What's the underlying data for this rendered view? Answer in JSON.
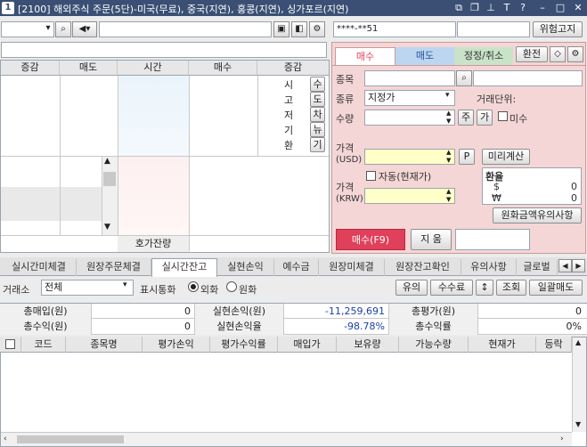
{
  "window": {
    "number": "1",
    "title": "[2100] 해외주식 주문(5단)-미국(무료), 중국(지연), 홍콩(지연), 싱가포르(지연)"
  },
  "toolbar": {
    "account_masked": "****-**51",
    "risk_notice": "위험고지"
  },
  "orderbook": {
    "headers": [
      "증감",
      "매도",
      "시간",
      "매수",
      "증감"
    ],
    "info_labels": [
      "시",
      "고",
      "저",
      "기",
      "환"
    ],
    "side_buttons": [
      "수",
      "도",
      "차",
      "뉴",
      "기"
    ],
    "remaining_label": "호가잔량"
  },
  "order": {
    "tabs": [
      "매수",
      "매도",
      "정정/취소"
    ],
    "exchange_button": "환전",
    "fields": {
      "stock_label": "종목",
      "type_label": "종류",
      "type_value": "지정가",
      "unit_label": "거래단위:",
      "qty_label": "수량",
      "qty_unit": "주",
      "qty_max": "가",
      "naked_label": "미수",
      "price_usd_label": "가격",
      "price_usd_unit": "(USD)",
      "p_button": "P",
      "precalc_button": "미리계산",
      "auto_label": "자동(현재가)",
      "price_krw_label": "가격",
      "price_krw_unit": "(KRW)",
      "fx_title": "환율",
      "fx_usd_sym": "$",
      "fx_usd_value": "0",
      "fx_krw_sym": "₩",
      "fx_krw_value": "0",
      "fx_notice_button": "원화금액유의사항",
      "submit_button": "매수(F9)",
      "reset_button": "지 움"
    }
  },
  "bottom_tabs": [
    "실시간미체결",
    "원장주문체결",
    "실시간잔고",
    "실현손익",
    "예수금",
    "원장미체결",
    "원장잔고확인",
    "유의사항",
    "글로벌"
  ],
  "active_tab": "실시간잔고",
  "filter": {
    "exchange_label": "거래소",
    "exchange_value": "전체",
    "currency_label": "표시통화",
    "opt_foreign": "외화",
    "opt_krw": "원화",
    "buttons": [
      "유의",
      "수수료",
      "↕",
      "조회",
      "일괄매도"
    ]
  },
  "summary": {
    "r1": [
      {
        "label": "총매입(원)",
        "value": "0"
      },
      {
        "label": "실현손익(원)",
        "value": "-11,259,691"
      },
      {
        "label": "총평가(원)",
        "value": "0"
      }
    ],
    "r2": [
      {
        "label": "총수익(원)",
        "value": "0"
      },
      {
        "label": "실현손익율",
        "value": "-98.78%"
      },
      {
        "label": "총수익률",
        "value": "0%"
      }
    ]
  },
  "columns": [
    "코드",
    "종목명",
    "평가손익",
    "평가수익률",
    "매입가",
    "보유량",
    "가능수량",
    "현재가",
    "등락"
  ],
  "colors": {
    "sell_red": "#e0405a",
    "buy_tab": "#ffffff",
    "sell_tab": "#bcd6f0",
    "loss_blue": "#1c3fa8"
  }
}
